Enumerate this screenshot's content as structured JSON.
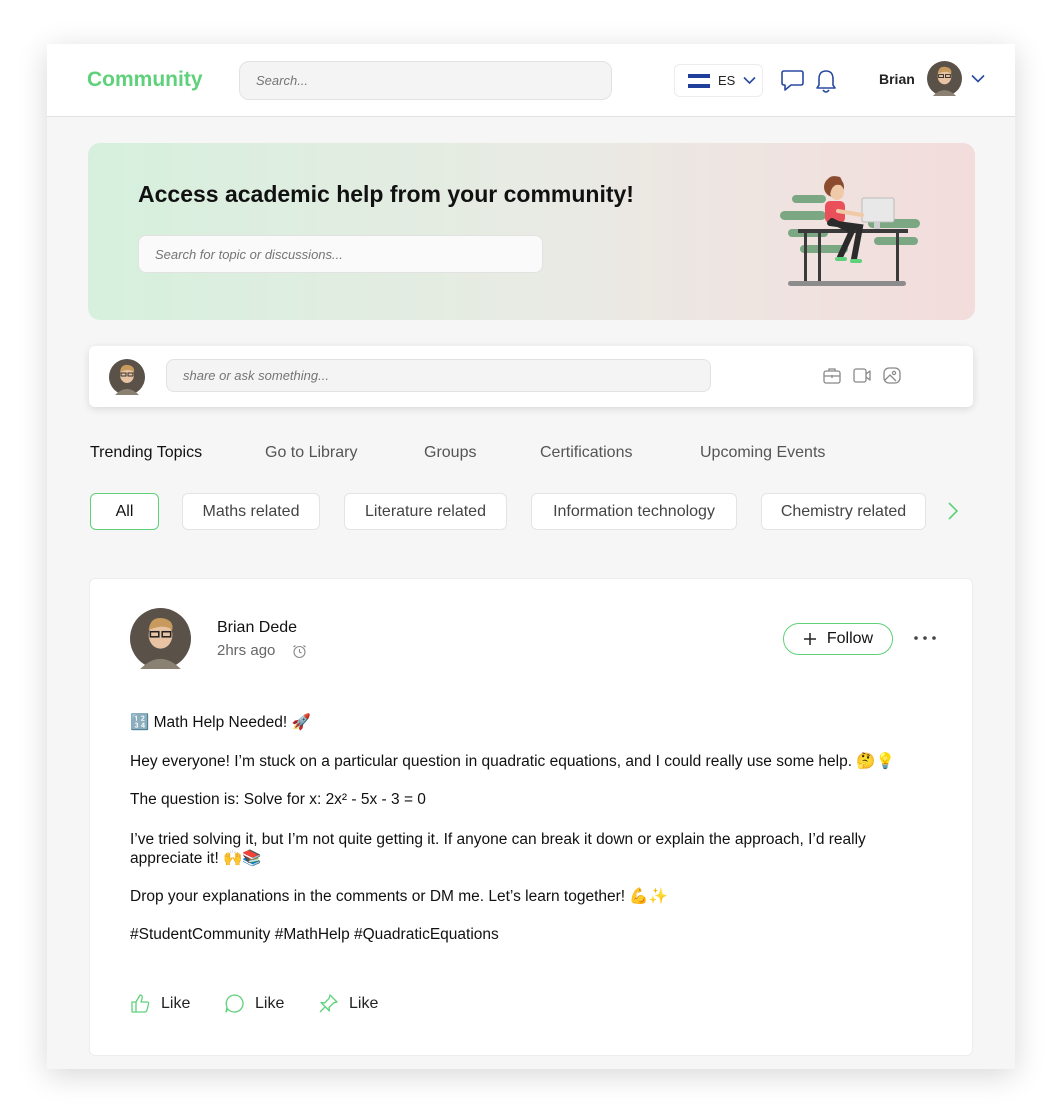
{
  "header": {
    "logo": "Community",
    "search_placeholder": "Search...",
    "language": "ES",
    "user_name": "Brian"
  },
  "banner": {
    "title": "Access academic help from your community!",
    "search_placeholder": "Search for topic or discussions..."
  },
  "composer": {
    "placeholder": "share or ask something..."
  },
  "tabs": [
    "Trending Topics",
    "Go to Library",
    "Groups",
    "Certifications",
    "Upcoming Events"
  ],
  "filters": [
    "All",
    "Maths related",
    "Literature related",
    "Information technology",
    "Chemistry related"
  ],
  "post": {
    "author": "Brian Dede",
    "time": "2hrs ago",
    "follow_label": "Follow",
    "lines": [
      "🔢 Math Help Needed! 🚀",
      "Hey everyone! I’m stuck on a particular question in quadratic equations, and I could really use some help. 🤔💡",
      "The question is: Solve for x: 2x² - 5x - 3 = 0",
      "I’ve tried solving it, but I’m not quite getting it. If anyone can break it down or explain the approach, I’d really appreciate it! 🙌📚",
      "Drop your explanations in the comments or DM me. Let’s learn together! 💪✨",
      "#StudentCommunity #MathHelp #QuadraticEquations"
    ],
    "actions": [
      "Like",
      "Like",
      "Like"
    ]
  },
  "colors": {
    "accent": "#5fd17a",
    "flag_blue": "#1f3f9a",
    "illustration_green": "#7ba883",
    "illustration_red": "#e9505a"
  },
  "icons": [
    "chevron-down-icon",
    "chat-bubble-icon",
    "bell-icon",
    "briefcase-icon",
    "video-icon",
    "image-icon",
    "chevron-right-icon",
    "clock-icon",
    "plus-icon",
    "more-icon",
    "thumbs-up-icon",
    "comment-icon",
    "pin-icon"
  ]
}
